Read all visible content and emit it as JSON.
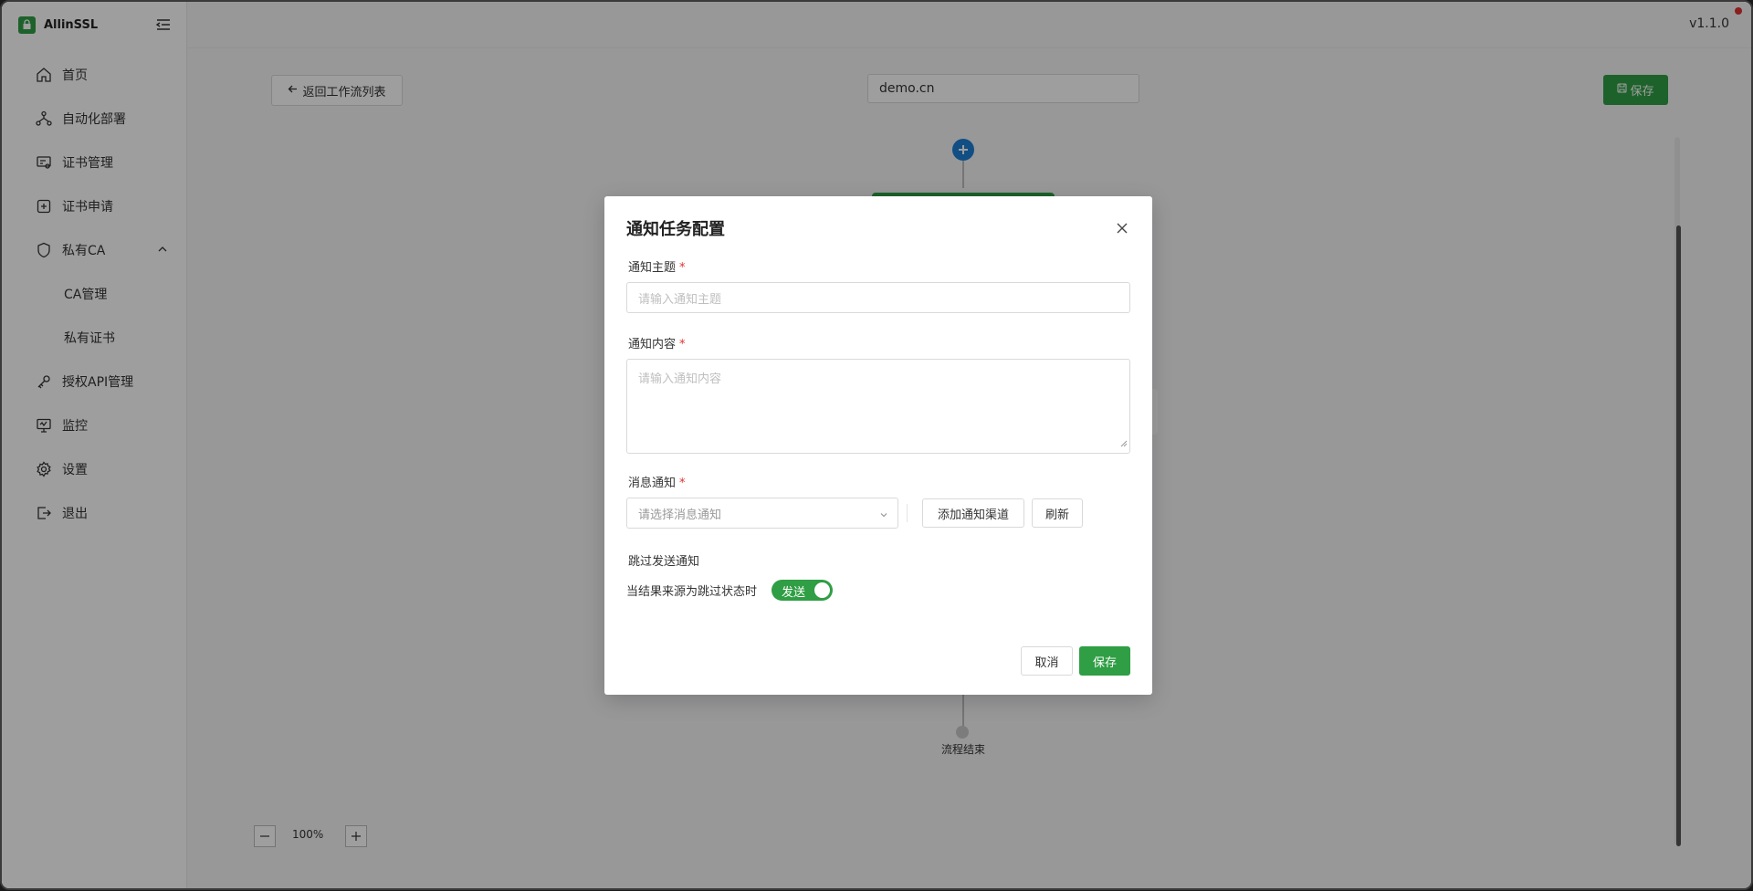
{
  "brand": {
    "name": "AllinSSL",
    "logo_icon": "lock-icon",
    "accent": "#2f9e44"
  },
  "topbar": {
    "version": "v1.1.0"
  },
  "sidebar": {
    "items": [
      {
        "label": "首页",
        "icon": "home-icon"
      },
      {
        "label": "自动化部署",
        "icon": "workflow-icon"
      },
      {
        "label": "证书管理",
        "icon": "certificate-icon"
      },
      {
        "label": "证书申请",
        "icon": "plus-square-icon"
      },
      {
        "label": "私有CA",
        "icon": "shield-icon",
        "expanded": true,
        "children": [
          {
            "label": "CA管理"
          },
          {
            "label": "私有证书"
          }
        ]
      },
      {
        "label": "授权API管理",
        "icon": "key-icon"
      },
      {
        "label": "监控",
        "icon": "monitor-icon"
      },
      {
        "label": "设置",
        "icon": "gear-icon"
      },
      {
        "label": "退出",
        "icon": "logout-icon"
      }
    ]
  },
  "workflow": {
    "back_label": "返回工作流列表",
    "name": "demo.cn",
    "save_label": "保存",
    "end_label": "流程结束",
    "zoom": "100%"
  },
  "modal": {
    "title": "通知任务配置",
    "subject_label": "通知主题",
    "subject_placeholder": "请输入通知主题",
    "content_label": "通知内容",
    "content_placeholder": "请输入通知内容",
    "channel_label": "消息通知",
    "channel_placeholder": "请选择消息通知",
    "add_channel_label": "添加通知渠道",
    "refresh_label": "刷新",
    "skip_title": "跳过发送通知",
    "skip_desc": "当结果来源为跳过状态时",
    "toggle_text": "发送",
    "toggle_on": true,
    "cancel_label": "取消",
    "save_label": "保存"
  }
}
